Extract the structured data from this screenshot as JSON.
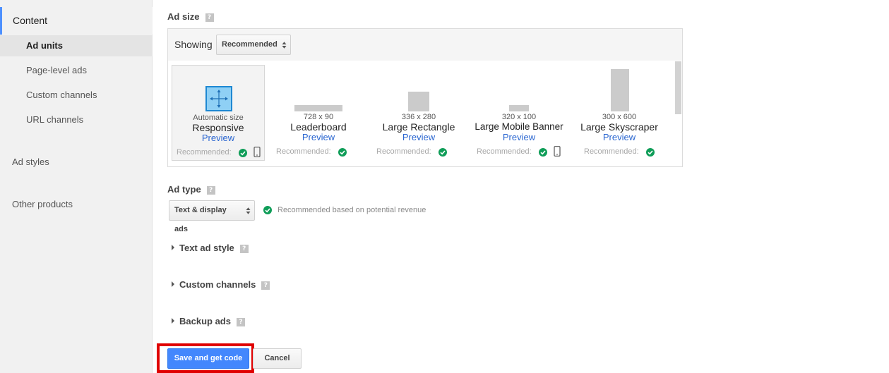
{
  "sidebar": {
    "heading": "Content",
    "items": [
      {
        "label": "Ad units",
        "active": true
      },
      {
        "label": "Page-level ads"
      },
      {
        "label": "Custom channels"
      },
      {
        "label": "URL channels"
      }
    ],
    "groups": [
      "Ad styles",
      "Other products"
    ]
  },
  "ad_size": {
    "title": "Ad size",
    "help": "?",
    "showing_label": "Showing",
    "showing_value": "Recommended",
    "sizes": [
      {
        "dims": "Automatic size",
        "name": "Responsive",
        "preview": "Preview",
        "recommended": "Recommended:",
        "selected": true,
        "mobile": true
      },
      {
        "dims": "728 x 90",
        "name": "Leaderboard",
        "preview": "Preview",
        "recommended": "Recommended:"
      },
      {
        "dims": "336 x 280",
        "name": "Large Rectangle",
        "preview": "Preview",
        "recommended": "Recommended:"
      },
      {
        "dims": "320 x 100",
        "name": "Large Mobile Banner",
        "preview": "Preview",
        "recommended": "Recommended:",
        "mobile": true
      },
      {
        "dims": "300 x 600",
        "name": "Large Skyscraper",
        "preview": "Preview",
        "recommended": "Recommended:"
      }
    ]
  },
  "ad_type": {
    "title": "Ad type",
    "help": "?",
    "value": "Text & display ads",
    "note": "Recommended based on potential revenue"
  },
  "sections": [
    {
      "label": "Text ad style",
      "help": "?"
    },
    {
      "label": "Custom channels",
      "help": "?"
    },
    {
      "label": "Backup ads",
      "help": "?"
    }
  ],
  "actions": {
    "save": "Save and get code",
    "cancel": "Cancel"
  },
  "colors": {
    "accent": "#4d90fe",
    "primary_button": "#4387fd",
    "check_green": "#0f9d58",
    "highlight": "#e00000",
    "link": "#2a66d0"
  }
}
